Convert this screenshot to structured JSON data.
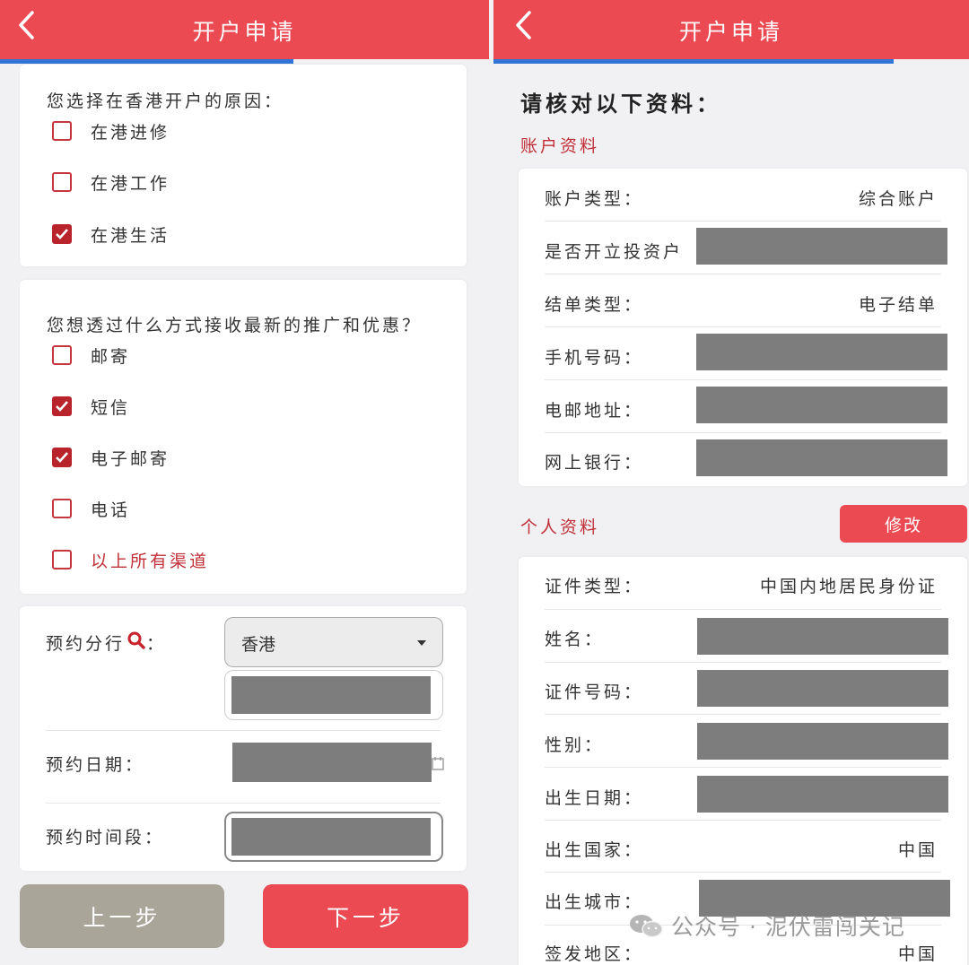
{
  "left": {
    "header": {
      "title": "开户申请",
      "back_icon": "chevron-left-icon"
    },
    "reason": {
      "question": "您选择在香港开户的原因：",
      "options": [
        {
          "label": "在港进修",
          "checked": false
        },
        {
          "label": "在港工作",
          "checked": false
        },
        {
          "label": "在港生活",
          "checked": true
        }
      ]
    },
    "promo": {
      "question": "您想透过什么方式接收最新的推广和优惠？",
      "options": [
        {
          "label": "邮寄",
          "checked": false
        },
        {
          "label": "短信",
          "checked": true
        },
        {
          "label": "电子邮寄",
          "checked": true
        },
        {
          "label": "电话",
          "checked": false
        },
        {
          "label": "以上所有渠道",
          "checked": false
        }
      ]
    },
    "appointment": {
      "branch_label": "预约分行",
      "branch_colon": "：",
      "branch_value": "香港",
      "date_label": "预约日期：",
      "time_label": "预约时间段："
    },
    "buttons": {
      "prev": "上一步",
      "next": "下一步"
    }
  },
  "right": {
    "header": {
      "title": "开户申请",
      "back_icon": "chevron-left-icon"
    },
    "verify_title": "请核对以下资料：",
    "account_section": {
      "title": "账户资料",
      "rows": [
        {
          "label": "账户类型：",
          "value": "综合账户"
        },
        {
          "label": "是否开立投资户",
          "value": ""
        },
        {
          "label": "结单类型：",
          "value": "电子结单"
        },
        {
          "label": "手机号码：",
          "value": ""
        },
        {
          "label": "电邮地址：",
          "value": ""
        },
        {
          "label": "网上银行：",
          "value": ""
        }
      ]
    },
    "personal_section": {
      "title": "个人资料",
      "edit_button": "修改",
      "rows": [
        {
          "label": "证件类型：",
          "value": "中国内地居民身份证"
        },
        {
          "label": "姓名：",
          "value": ""
        },
        {
          "label": "证件号码：",
          "value": ""
        },
        {
          "label": "性别：",
          "value": ""
        },
        {
          "label": "出生日期：",
          "value": ""
        },
        {
          "label": "出生国家：",
          "value": "中国"
        },
        {
          "label": "出生城市：",
          "value": ""
        },
        {
          "label": "签发地区：",
          "value": "中国"
        }
      ]
    }
  },
  "watermark": "公众号 · 泥伏雷闯关记",
  "colors": {
    "header": "#ec4a52",
    "progress": "#2f74d6",
    "checkbox": "#b8232c",
    "accent_text": "#c13038",
    "prev_button": "#a9a699",
    "redacted": "#7d7d7d"
  }
}
